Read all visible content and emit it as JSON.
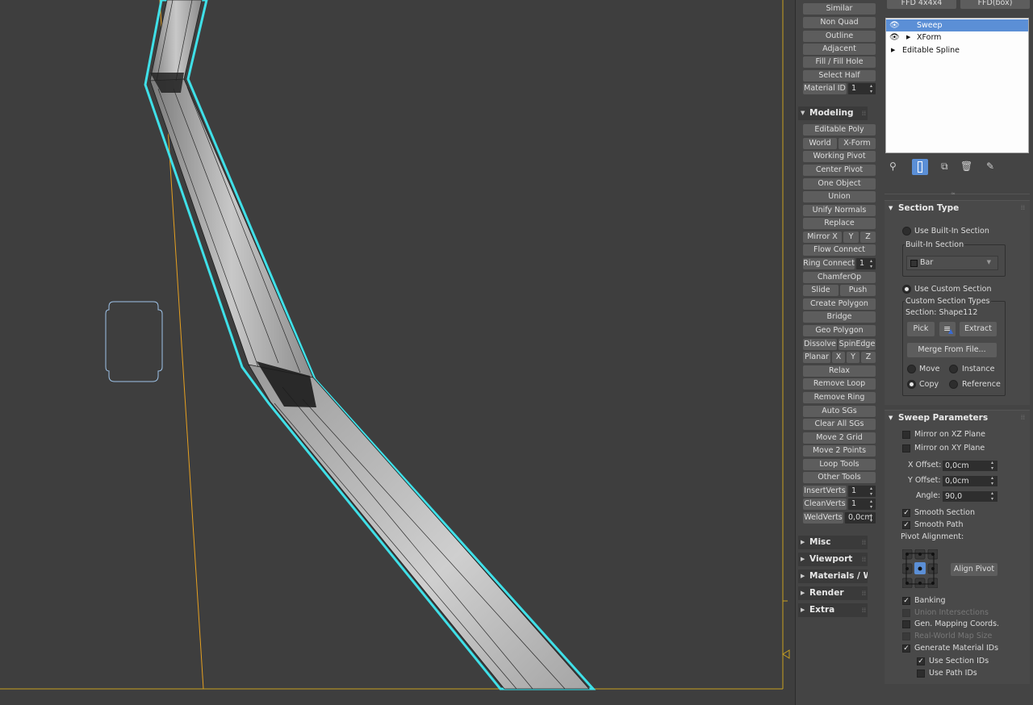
{
  "header_buttons": [
    "FFD 4x4x4",
    "FFD(box)"
  ],
  "modifier_stack": [
    {
      "label": "Sweep",
      "visible_eye": true,
      "expandable": false,
      "selected": true
    },
    {
      "label": "XForm",
      "visible_eye": true,
      "expandable": true,
      "selected": false
    },
    {
      "label": "Editable Spline",
      "visible_eye": false,
      "expandable": true,
      "selected": false
    }
  ],
  "selection_tools": {
    "similar": "Similar",
    "non_quad": "Non Quad",
    "outline": "Outline",
    "adjacent": "Adjacent",
    "fill_hole": "Fill / Fill Hole",
    "select_half": "Select Half",
    "material_id_label": "Material ID",
    "material_id_value": "1"
  },
  "modeling": {
    "title": "Modeling",
    "editable_poly": "Editable Poly",
    "world": "World",
    "xform": "X-Form",
    "working_pivot": "Working Pivot",
    "center_pivot": "Center Pivot",
    "one_object": "One Object",
    "union": "Union",
    "unify_normals": "Unify Normals",
    "replace": "Replace",
    "mirror_x": "Mirror X",
    "mirror_y": "Y",
    "mirror_z": "Z",
    "flow_connect": "Flow Connect",
    "ring_connect": "Ring Connect",
    "ring_connect_value": "1",
    "chamfer_op": "ChamferOp",
    "slide": "Slide",
    "push": "Push",
    "create_polygon": "Create Polygon",
    "bridge": "Bridge",
    "geo_polygon": "Geo Polygon",
    "dissolve": "Dissolve",
    "spin_edge": "SpinEdge",
    "planar": "Planar",
    "planar_x": "X",
    "planar_y": "Y",
    "planar_z": "Z",
    "relax": "Relax",
    "remove_loop": "Remove Loop",
    "remove_ring": "Remove Ring",
    "auto_sgs": "Auto SGs",
    "clear_all_sgs": "Clear All SGs",
    "move_2_grid": "Move 2 Grid",
    "move_2_points": "Move 2 Points",
    "loop_tools": "Loop Tools",
    "other_tools": "Other Tools",
    "insert_verts": "InsertVerts",
    "insert_verts_value": "1",
    "clean_verts": "CleanVerts",
    "clean_verts_value": "1",
    "weld_verts": "WeldVerts",
    "weld_verts_value": "0,0cm"
  },
  "rollouts": [
    "Misc",
    "Viewport",
    "Materials / Wir",
    "Render",
    "Extra"
  ],
  "section_type": {
    "title": "Section Type",
    "use_builtin": "Use Built-In Section",
    "builtin_group": "Built-In Section",
    "builtin_value": "Bar",
    "use_custom": "Use Custom Section",
    "custom_group": "Custom Section Types",
    "section_name": "Section: Shape112",
    "pick": "Pick",
    "extract": "Extract",
    "merge_from_file": "Merge From File...",
    "move": "Move",
    "instance": "Instance",
    "copy": "Copy",
    "reference": "Reference"
  },
  "sweep_parameters": {
    "title": "Sweep Parameters",
    "mirror_xz": "Mirror on XZ Plane",
    "mirror_xy": "Mirror on XY Plane",
    "x_offset_label": "X Offset:",
    "x_offset_value": "0,0cm",
    "y_offset_label": "Y Offset:",
    "y_offset_value": "0,0cm",
    "angle_label": "Angle:",
    "angle_value": "90,0",
    "smooth_section": "Smooth Section",
    "smooth_path": "Smooth Path",
    "pivot_alignment": "Pivot Alignment:",
    "align_pivot": "Align Pivot",
    "banking": "Banking",
    "union_intersections": "Union Intersections",
    "gen_mapping": "Gen. Mapping Coords.",
    "real_world": "Real-World Map Size",
    "gen_material_ids": "Generate Material IDs",
    "use_section_ids": "Use Section IDs",
    "use_path_ids": "Use Path IDs"
  },
  "colors": {
    "viewport_bg": "#3e3e3e",
    "selection_outline": "#3fe0e8",
    "guide_line": "#e6a020",
    "stack_selected": "#5b8fd6",
    "active_icon": "#5b8fd6"
  }
}
